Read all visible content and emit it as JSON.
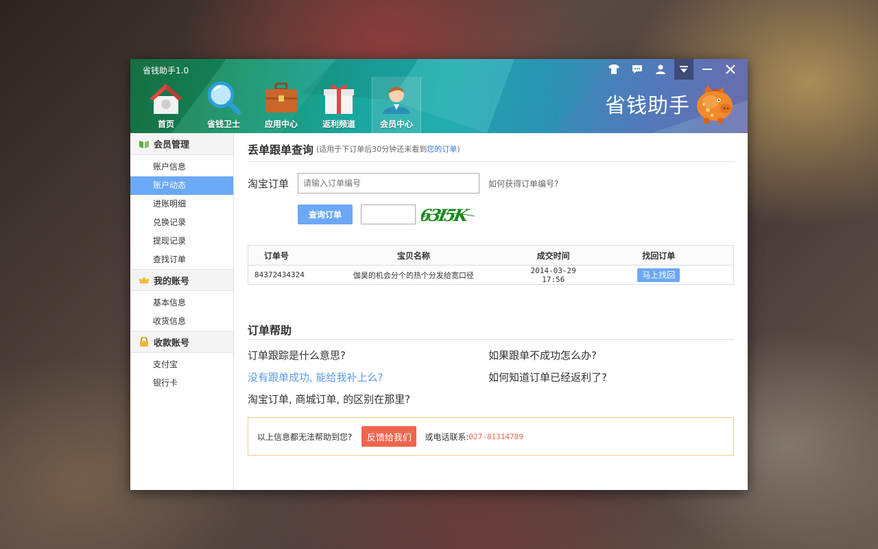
{
  "window": {
    "title": "省钱助手1.0"
  },
  "header": {
    "brand_text": "省钱助手",
    "nav": [
      {
        "label": "首页",
        "icon": "home-icon"
      },
      {
        "label": "省钱卫士",
        "icon": "magnifier-icon"
      },
      {
        "label": "应用中心",
        "icon": "briefcase-icon"
      },
      {
        "label": "返利频道",
        "icon": "gift-icon"
      },
      {
        "label": "会员中心",
        "icon": "member-icon",
        "active": true
      }
    ],
    "controls": [
      "skin-icon",
      "message-icon",
      "user-icon",
      "menu-icon",
      "minimize-icon",
      "close-icon"
    ]
  },
  "sidebar": {
    "groups": [
      {
        "title": "会员管理",
        "icon": "book-icon",
        "items": [
          "账户信息",
          "账户动态",
          "进账明细",
          "兑换记录",
          "提现记录",
          "查找订单"
        ]
      },
      {
        "title": "我的账号",
        "icon": "crown-icon",
        "items": [
          "基本信息",
          "收货信息"
        ]
      },
      {
        "title": "收款账号",
        "icon": "lock-icon",
        "items": [
          "支付宝",
          "银行卡"
        ]
      }
    ],
    "active_item": "账户动态"
  },
  "query": {
    "title": "丢单跟单查询",
    "note_prefix": "(适用于下订单后30分钟还未看到",
    "note_link": "您的订单",
    "note_suffix": ")",
    "label": "淘宝订单",
    "placeholder": "请输入订单编号",
    "how_link": "如何获得订单编号?",
    "button": "查询订单",
    "captcha_text": "63I5K"
  },
  "table": {
    "headers": [
      "订单号",
      "宝贝名称",
      "成交时间",
      "找回订单"
    ],
    "rows": [
      {
        "order_no": "84372434324",
        "item": "伽昊的机会分个的热个分发给宽口径",
        "time": "2014-03-29 17:56",
        "action": "马上找回"
      }
    ]
  },
  "help": {
    "title": "订单帮助",
    "faqs": [
      {
        "text": "订单跟踪是什么意思?",
        "link": false
      },
      {
        "text": "如果跟单不成功怎么办?",
        "link": false
      },
      {
        "text": "没有跟单成功, 能给我补上么?",
        "link": true
      },
      {
        "text": "如何知道订单已经返利了?",
        "link": false
      },
      {
        "text": "淘宝订单, 商城订单, 的区别在那里?",
        "link": false
      }
    ]
  },
  "contact": {
    "prompt": "以上信息都无法帮助到您?",
    "feedback_button": "反馈给我们",
    "phone_label": "或电话联系:",
    "phone": "027-81314789"
  },
  "colors": {
    "accent_blue": "#6ba8f5",
    "feedback_red": "#f0654e",
    "header_teal": "#1aa7a0"
  }
}
